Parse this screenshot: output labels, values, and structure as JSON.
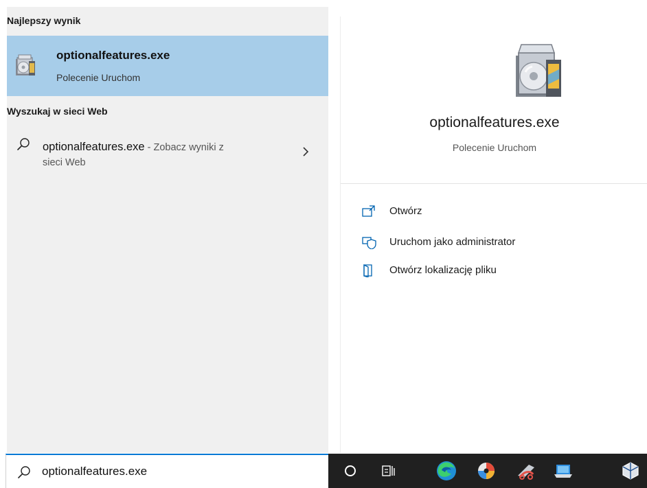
{
  "best_match": {
    "header": "Najlepszy wynik",
    "title": "optionalfeatures.exe",
    "subtitle": "Polecenie Uruchom",
    "icon": "installer-box-icon"
  },
  "web_search": {
    "header": "Wyszukaj w sieci Web",
    "query": "optionalfeatures.exe",
    "suffix": " - Zobacz wyniki z",
    "suffix_line2": "sieci Web",
    "icon": "search-icon"
  },
  "preview": {
    "title": "optionalfeatures.exe",
    "subtitle": "Polecenie Uruchom",
    "actions": [
      {
        "label": "Otwórz",
        "icon": "open-icon"
      },
      {
        "label": "Uruchom jako administrator",
        "icon": "shield-admin-icon"
      },
      {
        "label": "Otwórz lokalizację pliku",
        "icon": "folder-location-icon"
      }
    ]
  },
  "search": {
    "value": "optionalfeatures.exe"
  },
  "taskbar": {
    "items": [
      {
        "name": "cortana-icon"
      },
      {
        "name": "task-view-icon"
      },
      {
        "name": "edge-icon"
      },
      {
        "name": "dvd-icon"
      },
      {
        "name": "snipping-icon"
      },
      {
        "name": "remote-desktop-icon"
      },
      {
        "name": "virtualbox-icon"
      }
    ]
  },
  "colors": {
    "selected_bg": "#a7cde9",
    "panel_bg": "#f0f0f0",
    "accent": "#0078d4",
    "taskbar_bg": "#202020"
  }
}
